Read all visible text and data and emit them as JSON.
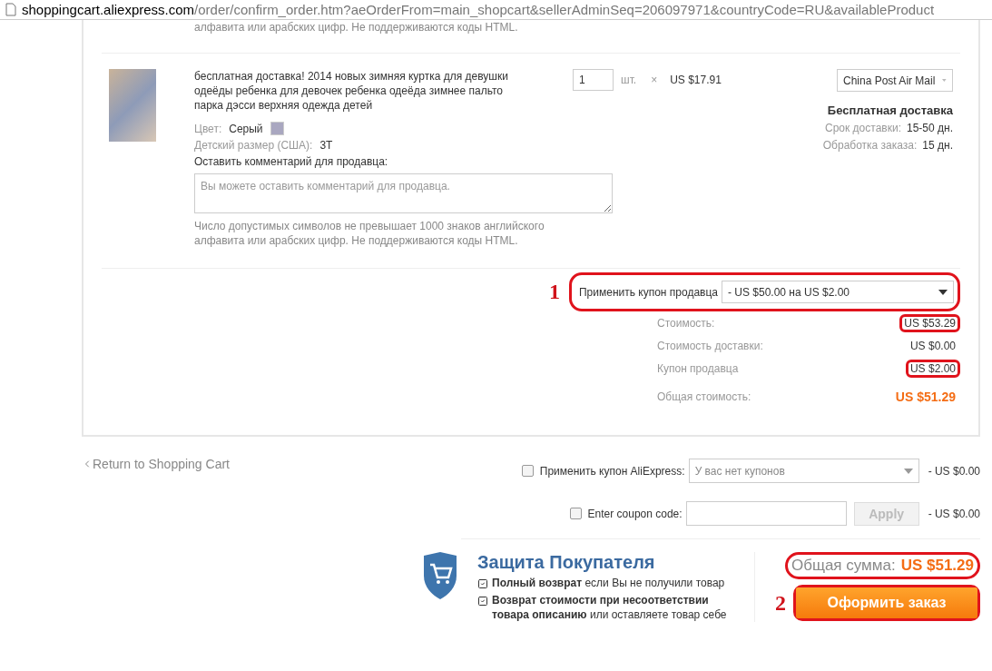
{
  "address_bar": {
    "host": "shoppingcart.aliexpress.com",
    "path": "/order/confirm_order.htm?aeOrderFrom=main_shopcart&sellerAdminSeq=206097971&countryCode=RU&availableProduct"
  },
  "previous_note": "алфавита или арабских цифр. Не поддерживаются коды HTML.",
  "product": {
    "title": "бесплатная доставка! 2014 новых зимняя куртка для девушки одеёды ребенка для девочек ребенка одеёда зимнее пальто парка дэсси верхняя одежда детей",
    "attributes": [
      {
        "label": "Цвет:",
        "value": "Серый",
        "swatch": true
      },
      {
        "label": "Детский размер (США):",
        "value": "3T",
        "swatch": false
      }
    ],
    "quantity": "1",
    "unit": "шт.",
    "times": "×",
    "price": "US $17.91",
    "shipping_method": "China Post Air Mail",
    "shipping_title": "Бесплатная доставка",
    "shipping_info": [
      {
        "label": "Срок доставки:",
        "value": "15-50 дн."
      },
      {
        "label": "Обработка заказа:",
        "value": "15 дн."
      }
    ],
    "comment_label": "Оставить комментарий для продавца:",
    "comment_placeholder": "Вы можете оставить комментарий для продавца.",
    "comment_note": "Число допустимых символов не превышает 1000 знаков английского алфавита или арабских цифр. Не поддерживаются коды HTML."
  },
  "seller_coupon": {
    "annotation": "1",
    "highlighted": true,
    "label": "Применить купон продавца",
    "value": "- US $50.00 на US $2.00"
  },
  "summary": [
    {
      "label": "Стоимость:",
      "value": "US $53.29",
      "highlighted": true,
      "kind": "plain"
    },
    {
      "label": "Стоимость доставки:",
      "value": "US $0.00",
      "highlighted": false,
      "kind": "plain"
    },
    {
      "label": "Купон продавца",
      "value": "US $2.00",
      "highlighted": true,
      "kind": "plain"
    },
    {
      "label": "Общая стоимость:",
      "value": "US $51.29",
      "highlighted": false,
      "kind": "total"
    }
  ],
  "return_link": "Return to Shopping Cart",
  "platform_coupons": [
    {
      "kind": "select",
      "checked": false,
      "label": "Применить купон AliExpress:",
      "placeholder": "У вас нет купонов",
      "amount": "- US $0.00"
    },
    {
      "kind": "code",
      "checked": false,
      "label": "Enter coupon code:",
      "button": "Apply",
      "amount": "- US $0.00"
    }
  ],
  "protection": {
    "title": "Защита Покупателя",
    "items": [
      "**Полный возврат** если Вы не получили товар",
      "**Возврат стоимости при несоответствии товара описанию** или оставляете товар себе"
    ]
  },
  "order": {
    "total_label": "Общая сумма:",
    "total_value": "US $51.29",
    "total_highlighted": true,
    "annotation": "2",
    "button": "Оформить заказ",
    "button_highlighted": true
  }
}
